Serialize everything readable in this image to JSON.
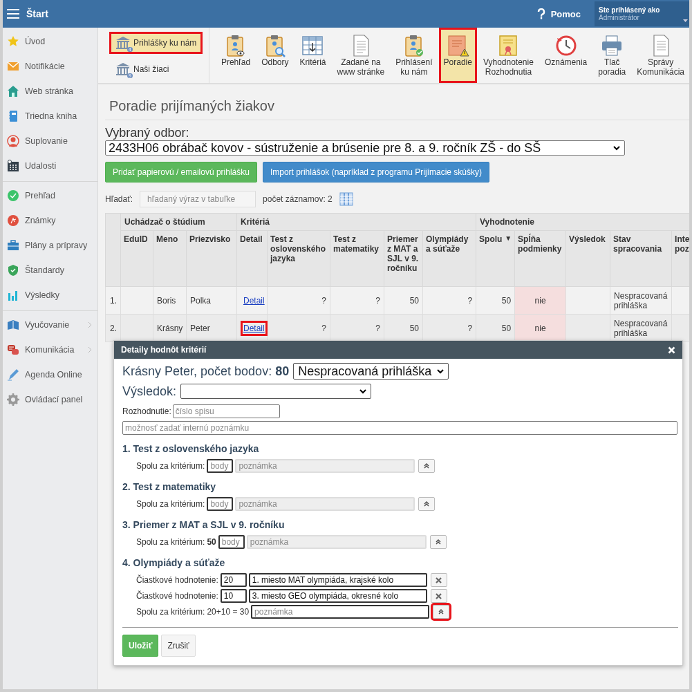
{
  "top_bar": {
    "title": "Štart",
    "help": "Pomoc",
    "user_label": "Ste prihlásený ako",
    "user_name": "Administrátor"
  },
  "sidebar": {
    "groups": [
      [
        {
          "label": "Úvod",
          "has_submenu": false
        },
        {
          "label": "Notifikácie",
          "has_submenu": false
        },
        {
          "label": "Web stránka",
          "has_submenu": false
        },
        {
          "label": "Triedna kniha",
          "has_submenu": false
        },
        {
          "label": "Suplovanie",
          "has_submenu": false
        },
        {
          "label": "Udalosti",
          "has_submenu": false
        }
      ],
      [
        {
          "label": "Prehľad",
          "has_submenu": false
        },
        {
          "label": "Známky",
          "has_submenu": false
        },
        {
          "label": "Plány a prípravy",
          "has_submenu": false
        },
        {
          "label": "Štandardy",
          "has_submenu": false
        },
        {
          "label": "Výsledky",
          "has_submenu": false
        }
      ],
      [
        {
          "label": "Vyučovanie",
          "has_submenu": true
        },
        {
          "label": "Komunikácia",
          "has_submenu": true
        },
        {
          "label": "Agenda Online",
          "has_submenu": false
        },
        {
          "label": "Ovládací panel",
          "has_submenu": false
        }
      ]
    ]
  },
  "toolbar": {
    "left_items": [
      {
        "label": "Prihlášky ku nám",
        "badge": "4",
        "selected": true,
        "highlighted": true
      },
      {
        "label": "Naši žiaci",
        "badge": "9",
        "selected": false,
        "highlighted": false
      }
    ],
    "items": [
      {
        "lines": [
          "Prehľad"
        ],
        "selected": false,
        "highlighted": false
      },
      {
        "lines": [
          "Odbory"
        ],
        "selected": false,
        "highlighted": false
      },
      {
        "lines": [
          "Kritériá"
        ],
        "selected": false,
        "highlighted": false
      },
      {
        "lines": [
          "Zadané na",
          "www stránke"
        ],
        "selected": false,
        "highlighted": false
      },
      {
        "lines": [
          "Prihlásení",
          "ku nám"
        ],
        "selected": false,
        "highlighted": false
      },
      {
        "lines": [
          "Poradie"
        ],
        "selected": true,
        "highlighted": true
      },
      {
        "lines": [
          "Vyhodnotenie",
          "Rozhodnutia"
        ],
        "selected": false,
        "highlighted": false
      },
      {
        "lines": [
          "Oznámenia"
        ],
        "selected": false,
        "highlighted": false
      },
      {
        "lines": [
          "Tlač",
          "poradia"
        ],
        "selected": false,
        "highlighted": false
      },
      {
        "lines": [
          "Správy",
          "Komunikácia"
        ],
        "selected": false,
        "highlighted": false
      }
    ]
  },
  "page": {
    "title": "Poradie prijímaných žiakov",
    "field_label": "Vybraný odbor:",
    "field_value": "2433H06 obrábač kovov - sústruženie a brúsenie pre 8. a 9. ročník ZŠ - do SŠ",
    "buttons": [
      {
        "label": "Pridať papierovú / emailovú prihlášku",
        "kind": "success"
      },
      {
        "label": "Import prihlášok (napríklad z programu Prijímacie skúšky)",
        "kind": "primary"
      }
    ],
    "search_label": "Hľadať:",
    "search": {
      "placeholder": "hľadaný výraz v tabuľke"
    },
    "count": "počet záznamov: 2"
  },
  "table": {
    "groups": [
      {
        "label": "Uchádzač o štúdium"
      },
      {
        "label": "Kritériá"
      },
      {
        "label": "Vyhodnotenie"
      }
    ],
    "columns": [
      {
        "label": "EduID"
      },
      {
        "label": "Meno"
      },
      {
        "label": "Priezvisko"
      },
      {
        "label": "Detail"
      },
      {
        "label": "Test z oslovenského jazyka"
      },
      {
        "label": "Test z matematiky"
      },
      {
        "label": "Priemer z MAT a SJL v 9. ročníku"
      },
      {
        "label": "Olympiády a súťaže"
      },
      {
        "label": "Spolu",
        "sort_mark": "▼"
      },
      {
        "label": "Spĺňa podmienky"
      },
      {
        "label": "Výsledok"
      },
      {
        "label": "Stav spracovania"
      },
      {
        "label": "Inte poz"
      }
    ],
    "rows": [
      {
        "num": "1.",
        "meno": "Boris",
        "priezvisko": "Polka",
        "detail": "Detail",
        "detail_highlighted": false,
        "test_sj": "?",
        "test_mat": "?",
        "priemer": "50",
        "olymp": "?",
        "spolu": "50",
        "meets_label": "nie",
        "meets": false,
        "stav": "Nespracovaná prihláška"
      },
      {
        "num": "2.",
        "meno": "Krásny",
        "priezvisko": "Peter",
        "detail": "Detail",
        "detail_highlighted": true,
        "test_sj": "?",
        "test_mat": "?",
        "priemer": "50",
        "olymp": "?",
        "spolu": "50",
        "meets_label": "nie",
        "meets": false,
        "stav": "Nespracovaná prihláška"
      }
    ]
  },
  "dialog": {
    "title": "Detaily hodnôt kritérií",
    "heading": "Krásny Peter, počet bodov: **80**",
    "status_value": "Nespracovaná prihláška",
    "result_label": "Výsledok:",
    "decision_label": "Rozhodnutie:",
    "decision": {
      "placeholder": "číslo spisu"
    },
    "note": {
      "placeholder": "možnosť zadať internú poznámku"
    },
    "sections": [
      {
        "title": "1. Test z oslovenského jazyka",
        "rows": [
          {
            "kind": "total",
            "label": "Spolu za kritérium:",
            "points": {
              "placeholder": "body"
            },
            "note": {
              "placeholder": "poznámka"
            },
            "note_disabled": true,
            "highlighted": false
          }
        ]
      },
      {
        "title": "2. Test z matematiky",
        "rows": [
          {
            "kind": "total",
            "label": "Spolu za kritérium:",
            "points": {
              "placeholder": "body"
            },
            "note": {
              "placeholder": "poznámka"
            },
            "note_disabled": true,
            "highlighted": false
          }
        ]
      },
      {
        "title": "3. Priemer z MAT a SJL v 9. ročníku",
        "rows": [
          {
            "kind": "total",
            "label": "Spolu za kritérium:",
            "computed": "50",
            "computed_bold": true,
            "points": {
              "placeholder": "body"
            },
            "note": {
              "placeholder": "poznámka"
            },
            "note_disabled": true,
            "highlighted": false
          }
        ]
      },
      {
        "title": "4. Olympiády a súťaže",
        "rows": [
          {
            "kind": "partial",
            "label": "Čiastkové hodnotenie:",
            "points_value": "20",
            "note_value": "1. miesto MAT olympiáda, krajské kolo"
          },
          {
            "kind": "partial",
            "label": "Čiastkové hodnotenie:",
            "points_value": "10",
            "note_value": "3. miesto GEO olympiáda, okresné kolo"
          },
          {
            "kind": "total",
            "label": "Spolu za kritérium:",
            "computed": "20+10 = 30",
            "computed_bold": false,
            "note": {
              "placeholder": "poznámka"
            },
            "note_disabled": false,
            "highlighted": true
          }
        ]
      }
    ],
    "buttons": [
      {
        "label": "Uložiť",
        "kind": "success"
      },
      {
        "label": "Zrušiť",
        "kind": "default"
      }
    ]
  }
}
